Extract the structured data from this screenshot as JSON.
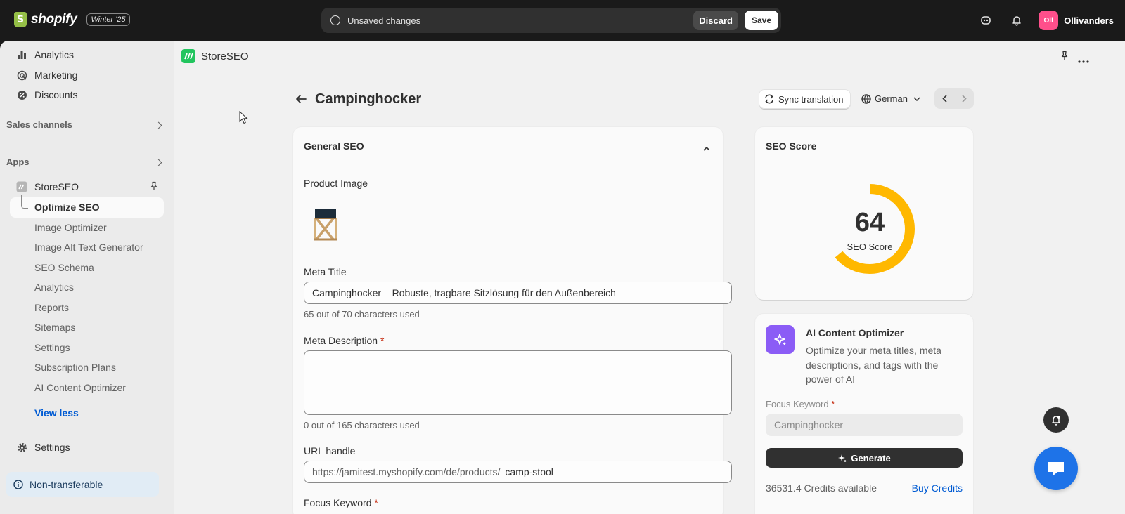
{
  "topbar": {
    "brand": "shopify",
    "edition_badge": "Winter '25",
    "unsaved_text": "Unsaved changes",
    "discard_label": "Discard",
    "save_label": "Save",
    "avatar_initials": "Oll",
    "store_name": "Ollivanders"
  },
  "sidebar": {
    "items": [
      {
        "label": "Analytics",
        "icon": "bar-chart-icon"
      },
      {
        "label": "Marketing",
        "icon": "target-icon"
      },
      {
        "label": "Discounts",
        "icon": "discount-icon"
      }
    ],
    "sales_channels_title": "Sales channels",
    "apps_title": "Apps",
    "app_name": "StoreSEO",
    "app_subitems": [
      "Optimize SEO",
      "Image Optimizer",
      "Image Alt Text Generator",
      "SEO Schema",
      "Analytics",
      "Reports",
      "Sitemaps",
      "Settings",
      "Subscription Plans",
      "AI Content Optimizer"
    ],
    "active_subitem": "Optimize SEO",
    "view_less": "View less",
    "settings_label": "Settings",
    "non_transferable": "Non-transferable"
  },
  "app_bar": {
    "app_name": "StoreSEO"
  },
  "page": {
    "title": "Campinghocker",
    "sync_label": "Sync translation",
    "language": "German"
  },
  "general_seo": {
    "heading": "General SEO",
    "product_image_label": "Product Image",
    "meta_title_label": "Meta Title",
    "meta_title_value": "Campinghocker – Robuste, tragbare Sitzlösung für den Außenbereich",
    "meta_title_helper": "65 out of 70 characters used",
    "meta_desc_label": "Meta Description",
    "meta_desc_required": "*",
    "meta_desc_value": "",
    "meta_desc_helper": "0 out of 165 characters used",
    "url_label": "URL handle",
    "url_prefix": "https://jamitest.myshopify.com/de/products/",
    "url_handle": "camp-stool",
    "focus_keyword_label": "Focus Keyword",
    "focus_keyword_required": "*"
  },
  "seo_score": {
    "heading": "SEO Score",
    "score": 64,
    "score_text": "64",
    "score_label": "SEO Score",
    "color": "#ffb800"
  },
  "ai_optimizer": {
    "title": "AI Content Optimizer",
    "description": "Optimize your meta titles, meta descriptions, and tags with the power of AI",
    "focus_keyword_label": "Focus Keyword",
    "focus_keyword_required": "*",
    "focus_keyword_value": "Campinghocker",
    "generate_label": "Generate",
    "credits_text": "36531.4 Credits available",
    "buy_label": "Buy Credits"
  }
}
